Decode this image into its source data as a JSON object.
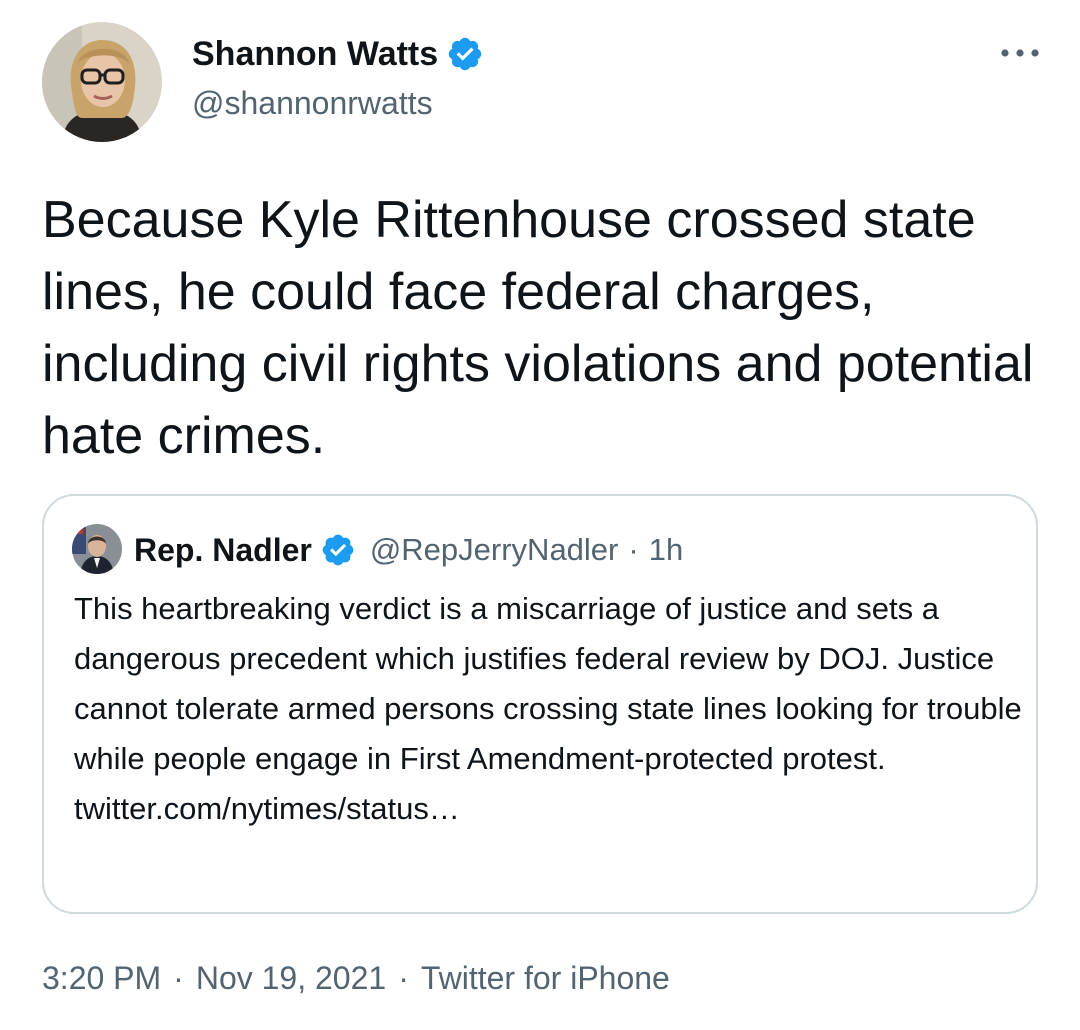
{
  "author": {
    "name": "Shannon Watts",
    "handle": "@shannonrwatts",
    "verified": true
  },
  "tweet": {
    "text": "Because Kyle Rittenhouse crossed state lines, he could face federal charges, including civil rights violations and potential hate crimes."
  },
  "quoted": {
    "name": "Rep. Nadler",
    "handle": "@RepJerryNadler",
    "separator": "·",
    "time": "1h",
    "verified": true,
    "text": "This heartbreaking verdict is a miscarriage of justice and sets a dangerous precedent which justifies federal review by DOJ. Justice cannot tolerate armed persons crossing state lines looking for trouble while people engage in First Amendment-protected protest.",
    "link": "twitter.com/nytimes/status…"
  },
  "meta": {
    "time": "3:20 PM",
    "separator": "·",
    "date": "Nov 19, 2021",
    "separator2": "·",
    "source": "Twitter for iPhone"
  },
  "icons": {
    "verified": "verified-badge-icon",
    "more": "more-horizontal-icon"
  },
  "colors": {
    "verified": "#1d9bf0",
    "text": "#0f1419",
    "secondary": "#536471",
    "border": "#cfd9de"
  }
}
